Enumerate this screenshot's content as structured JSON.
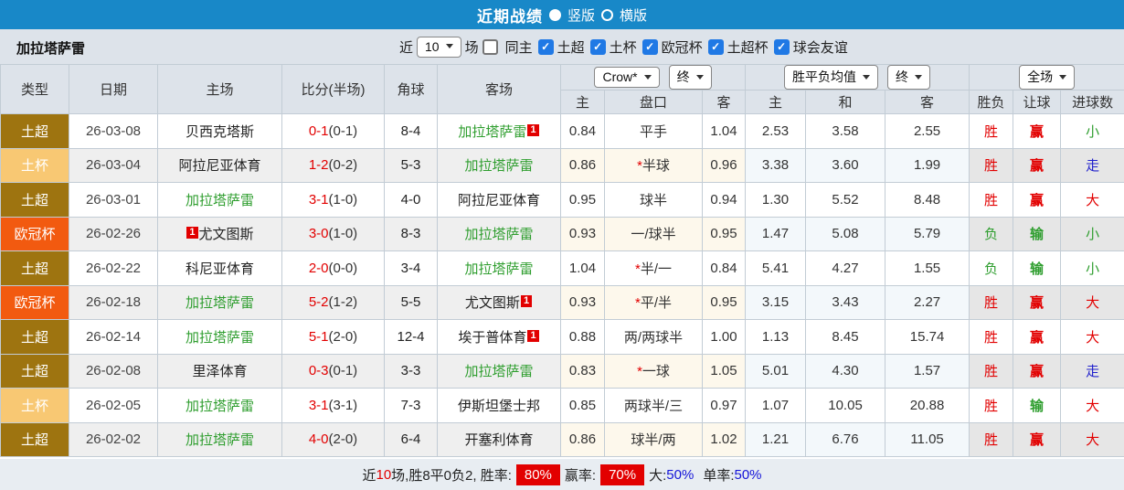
{
  "topbar": {
    "title": "近期战绩",
    "radio_vertical": "竖版",
    "radio_horizontal": "横版",
    "selected": "竖版"
  },
  "filter": {
    "team": "加拉塔萨雷",
    "near_label": "近",
    "matches_value": "10",
    "matches_label": "场",
    "same_home": {
      "label": "同主",
      "checked": false
    },
    "leagues": [
      {
        "label": "土超",
        "checked": true
      },
      {
        "label": "土杯",
        "checked": true
      },
      {
        "label": "欧冠杯",
        "checked": true
      },
      {
        "label": "土超杯",
        "checked": true
      },
      {
        "label": "球会友谊",
        "checked": true
      }
    ]
  },
  "table": {
    "left_headers": [
      "类型",
      "日期",
      "主场",
      "比分(半场)",
      "角球",
      "客场"
    ],
    "selects": {
      "odds_company": "Crow*",
      "odds_final": "终",
      "avg": "胜平负均值",
      "avg_final": "终",
      "scope": "全场"
    },
    "sub_headers": [
      "主",
      "盘口",
      "客",
      "主",
      "和",
      "客",
      "胜负",
      "让球",
      "进球数"
    ],
    "rows": [
      {
        "type": "土超",
        "date": "26-03-08",
        "home": "贝西克塔斯",
        "home_green": false,
        "home_badge": "",
        "home_badge_pos": "",
        "score": "0-1",
        "half": "(0-1)",
        "corner": "8-4",
        "away": "加拉塔萨雷",
        "away_green": true,
        "away_badge": "1",
        "away_badge_pos": "after",
        "odds_home": "0.84",
        "handicap": "平手",
        "handicap_star": false,
        "odds_away": "1.04",
        "avg_win": "2.53",
        "avg_draw": "3.58",
        "avg_lose": "2.55",
        "wl": "胜",
        "hresult": "赢",
        "goals": "小"
      },
      {
        "type": "土杯",
        "date": "26-03-04",
        "home": "阿拉尼亚体育",
        "home_green": false,
        "home_badge": "",
        "home_badge_pos": "",
        "score": "1-2",
        "half": "(0-2)",
        "corner": "5-3",
        "away": "加拉塔萨雷",
        "away_green": true,
        "away_badge": "",
        "away_badge_pos": "",
        "odds_home": "0.86",
        "handicap": "半球",
        "handicap_star": true,
        "odds_away": "0.96",
        "avg_win": "3.38",
        "avg_draw": "3.60",
        "avg_lose": "1.99",
        "wl": "胜",
        "hresult": "赢",
        "goals": "走"
      },
      {
        "type": "土超",
        "date": "26-03-01",
        "home": "加拉塔萨雷",
        "home_green": true,
        "home_badge": "",
        "home_badge_pos": "",
        "score": "3-1",
        "half": "(1-0)",
        "corner": "4-0",
        "away": "阿拉尼亚体育",
        "away_green": false,
        "away_badge": "",
        "away_badge_pos": "",
        "odds_home": "0.95",
        "handicap": "球半",
        "handicap_star": false,
        "odds_away": "0.94",
        "avg_win": "1.30",
        "avg_draw": "5.52",
        "avg_lose": "8.48",
        "wl": "胜",
        "hresult": "赢",
        "goals": "大"
      },
      {
        "type": "欧冠杯",
        "date": "26-02-26",
        "home": "尤文图斯",
        "home_green": false,
        "home_badge": "1",
        "home_badge_pos": "before",
        "score": "3-0",
        "half": "(1-0)",
        "corner": "8-3",
        "away": "加拉塔萨雷",
        "away_green": true,
        "away_badge": "",
        "away_badge_pos": "",
        "odds_home": "0.93",
        "handicap": "一/球半",
        "handicap_star": false,
        "odds_away": "0.95",
        "avg_win": "1.47",
        "avg_draw": "5.08",
        "avg_lose": "5.79",
        "wl": "负",
        "hresult": "输",
        "goals": "小"
      },
      {
        "type": "土超",
        "date": "26-02-22",
        "home": "科尼亚体育",
        "home_green": false,
        "home_badge": "",
        "home_badge_pos": "",
        "score": "2-0",
        "half": "(0-0)",
        "corner": "3-4",
        "away": "加拉塔萨雷",
        "away_green": true,
        "away_badge": "",
        "away_badge_pos": "",
        "odds_home": "1.04",
        "handicap": "半/一",
        "handicap_star": true,
        "odds_away": "0.84",
        "avg_win": "5.41",
        "avg_draw": "4.27",
        "avg_lose": "1.55",
        "wl": "负",
        "hresult": "输",
        "goals": "小"
      },
      {
        "type": "欧冠杯",
        "date": "26-02-18",
        "home": "加拉塔萨雷",
        "home_green": true,
        "home_badge": "",
        "home_badge_pos": "",
        "score": "5-2",
        "half": "(1-2)",
        "corner": "5-5",
        "away": "尤文图斯",
        "away_green": false,
        "away_badge": "1",
        "away_badge_pos": "after",
        "odds_home": "0.93",
        "handicap": "平/半",
        "handicap_star": true,
        "odds_away": "0.95",
        "avg_win": "3.15",
        "avg_draw": "3.43",
        "avg_lose": "2.27",
        "wl": "胜",
        "hresult": "赢",
        "goals": "大"
      },
      {
        "type": "土超",
        "date": "26-02-14",
        "home": "加拉塔萨雷",
        "home_green": true,
        "home_badge": "",
        "home_badge_pos": "",
        "score": "5-1",
        "half": "(2-0)",
        "corner": "12-4",
        "away": "埃于普体育",
        "away_green": false,
        "away_badge": "1",
        "away_badge_pos": "after",
        "odds_home": "0.88",
        "handicap": "两/两球半",
        "handicap_star": false,
        "odds_away": "1.00",
        "avg_win": "1.13",
        "avg_draw": "8.45",
        "avg_lose": "15.74",
        "wl": "胜",
        "hresult": "赢",
        "goals": "大"
      },
      {
        "type": "土超",
        "date": "26-02-08",
        "home": "里泽体育",
        "home_green": false,
        "home_badge": "",
        "home_badge_pos": "",
        "score": "0-3",
        "half": "(0-1)",
        "corner": "3-3",
        "away": "加拉塔萨雷",
        "away_green": true,
        "away_badge": "",
        "away_badge_pos": "",
        "odds_home": "0.83",
        "handicap": "一球",
        "handicap_star": true,
        "odds_away": "1.05",
        "avg_win": "5.01",
        "avg_draw": "4.30",
        "avg_lose": "1.57",
        "wl": "胜",
        "hresult": "赢",
        "goals": "走"
      },
      {
        "type": "土杯",
        "date": "26-02-05",
        "home": "加拉塔萨雷",
        "home_green": true,
        "home_badge": "",
        "home_badge_pos": "",
        "score": "3-1",
        "half": "(3-1)",
        "corner": "7-3",
        "away": "伊斯坦堡士邦",
        "away_green": false,
        "away_badge": "",
        "away_badge_pos": "",
        "odds_home": "0.85",
        "handicap": "两球半/三",
        "handicap_star": false,
        "odds_away": "0.97",
        "avg_win": "1.07",
        "avg_draw": "10.05",
        "avg_lose": "20.88",
        "wl": "胜",
        "hresult": "输",
        "goals": "大"
      },
      {
        "type": "土超",
        "date": "26-02-02",
        "home": "加拉塔萨雷",
        "home_green": true,
        "home_badge": "",
        "home_badge_pos": "",
        "score": "4-0",
        "half": "(2-0)",
        "corner": "6-4",
        "away": "开塞利体育",
        "away_green": false,
        "away_badge": "",
        "away_badge_pos": "",
        "odds_home": "0.86",
        "handicap": "球半/两",
        "handicap_star": false,
        "odds_away": "1.02",
        "avg_win": "1.21",
        "avg_draw": "6.76",
        "avg_lose": "11.05",
        "wl": "胜",
        "hresult": "赢",
        "goals": "大"
      }
    ]
  },
  "colors": {
    "type_colors": {
      "土超": "#9e7410",
      "土杯": "#f8c873",
      "欧冠杯": "#f25a10"
    },
    "result_colors": {
      "胜": "#e20000",
      "负": "#2f9e2f",
      "赢": "#e20000",
      "输": "#2f9e2f",
      "大": "#e20000",
      "小": "#2f9e2f",
      "走": "#2222cc"
    },
    "topbar_blue": "#1888c8",
    "team_green": "#2f9e2f",
    "badge_red": "#e20000"
  },
  "footer": {
    "seg_near": "近",
    "count": "10",
    "seg_stats": "场,胜8平0负2, 胜率:",
    "win_rate": "80%",
    "seg_profit": "赢率:",
    "profit_rate": "70%",
    "big_label": "大:",
    "big_value": "50%",
    "single_label": "单率:",
    "single_value": "50%"
  }
}
